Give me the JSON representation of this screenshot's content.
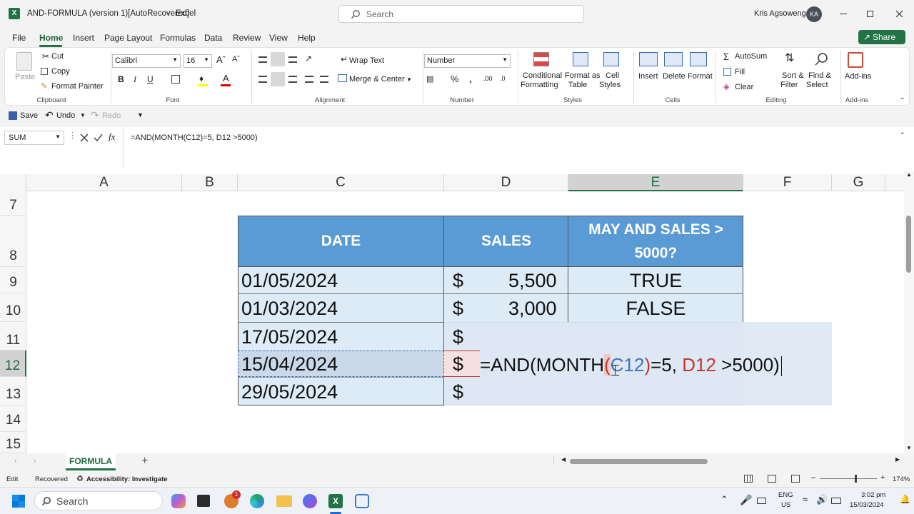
{
  "titlebar": {
    "app_icon": "excel-icon",
    "doc_title": "AND-FORMULA (version 1)[AutoRecovered]",
    "separator": "-",
    "app_name": "Excel",
    "search_placeholder": "Search",
    "user_name": "Kris Agsoweng",
    "user_initials": "KA"
  },
  "menu": {
    "items": [
      "File",
      "Home",
      "Insert",
      "Page Layout",
      "Formulas",
      "Data",
      "Review",
      "View",
      "Help"
    ],
    "active": "Home",
    "share_label": "Share"
  },
  "ribbon": {
    "clipboard": {
      "paste": "Paste",
      "cut": "Cut",
      "copy": "Copy",
      "format_painter": "Format Painter",
      "group": "Clipboard"
    },
    "font": {
      "name": "Calibri",
      "size": "16",
      "bold": "B",
      "italic": "I",
      "underline": "U",
      "group": "Font"
    },
    "alignment": {
      "wrap": "Wrap Text",
      "merge": "Merge & Center",
      "group": "Alignment"
    },
    "number": {
      "format": "Number",
      "group": "Number"
    },
    "styles": {
      "cond1": "Conditional",
      "cond2": "Formatting",
      "fmt1": "Format as",
      "fmt2": "Table",
      "cell1": "Cell",
      "cell2": "Styles",
      "group": "Styles"
    },
    "cells": {
      "insert": "Insert",
      "delete": "Delete",
      "format": "Format",
      "group": "Cells"
    },
    "editing": {
      "autosum": "AutoSum",
      "fill": "Fill",
      "clear": "Clear",
      "sort1": "Sort &",
      "sort2": "Filter",
      "find1": "Find &",
      "find2": "Select",
      "group": "Editing"
    },
    "addins": {
      "label": "Add-ins",
      "group": "Add-ins"
    }
  },
  "qat": {
    "save": "Save",
    "undo": "Undo",
    "redo": "Redo"
  },
  "formula_bar": {
    "name_box": "SUM",
    "formula": "=AND(MONTH(C12)=5, D12 >5000)"
  },
  "grid": {
    "columns": [
      "A",
      "B",
      "C",
      "D",
      "E",
      "F",
      "G"
    ],
    "rows": [
      "7",
      "8",
      "9",
      "10",
      "11",
      "12",
      "13",
      "14",
      "15"
    ],
    "header": {
      "date": "DATE",
      "sales": "SALES",
      "result_line1": "MAY AND SALES >",
      "result_line2": "5000?"
    },
    "data": [
      {
        "date": "01/05/2024",
        "currency": "$",
        "sales": "5,500",
        "result": "TRUE"
      },
      {
        "date": "01/03/2024",
        "currency": "$",
        "sales": "3,000",
        "result": "FALSE"
      },
      {
        "date": "17/05/2024",
        "currency": "$",
        "sales": "",
        "result": ""
      },
      {
        "date": "15/04/2024",
        "currency": "$",
        "sales": "",
        "result": ""
      },
      {
        "date": "29/05/2024",
        "currency": "$",
        "sales": "",
        "result": ""
      }
    ],
    "edit_formula": {
      "p1": "=AND(MONTH",
      "p2": "(",
      "p3": "C12",
      ")": ")",
      "p4": ")",
      "p5": "=5, ",
      "p6": "D12",
      "p7": " >5000)"
    }
  },
  "tabs": {
    "sheet": "FORMULA",
    "add": "+"
  },
  "status": {
    "mode": "Edit",
    "recovered": "Recovered",
    "accessibility": "Accessibility: Investigate",
    "zoom": "174%"
  },
  "taskbar": {
    "search": "Search",
    "lang1": "ENG",
    "lang2": "US",
    "time": "3:02 pm",
    "date": "15/03/2024",
    "badge": "1"
  },
  "colors": {
    "excel_green": "#217346",
    "header_fill": "#5b9bd5",
    "row_fill": "#ddebf7",
    "ref_blue": "#4472c4",
    "ref_red": "#c0392b"
  }
}
